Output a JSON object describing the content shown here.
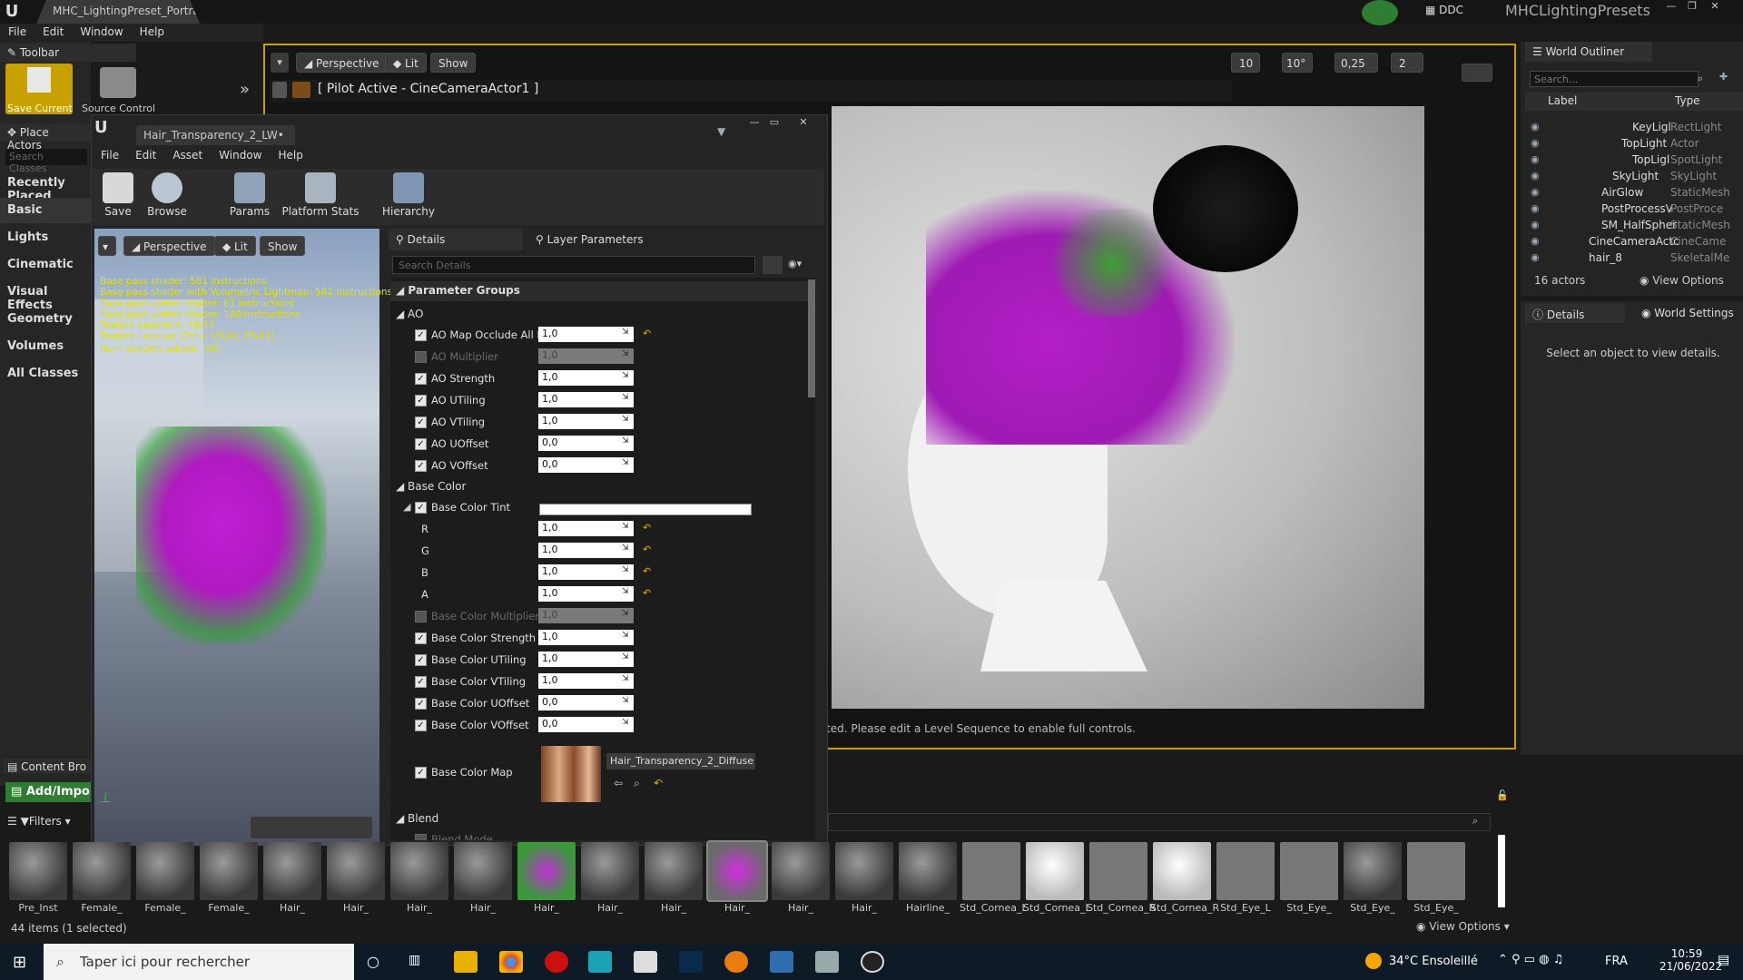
{
  "window": {
    "title_tab": "MHC_LightingPreset_Portra•",
    "project": "MHCLightingPresets",
    "ddc": "DDC"
  },
  "menubar": [
    "File",
    "Edit",
    "Window",
    "Help"
  ],
  "toolbar": {
    "title": "Toolbar",
    "save_label": "Save Current",
    "source_label": "Source Control"
  },
  "place_actors": {
    "title": "Place Actors",
    "search_placeholder": "Search Classes",
    "items": [
      "Recently Placed",
      "Basic",
      "Lights",
      "Cinematic",
      "Visual Effects",
      "Geometry",
      "Volumes",
      "All Classes"
    ]
  },
  "viewport": {
    "mode": "Perspective",
    "lit": "Lit",
    "show": "Show",
    "pilot": "[ Pilot Active - CineCameraActor1 ]",
    "grid": "10",
    "angle": "10°",
    "scale": "0,25",
    "cams": "2",
    "message": "ted. Please edit a Level Sequence to enable full controls."
  },
  "outliner": {
    "title": "World Outliner",
    "search": "Search...",
    "col_label": "Label",
    "col_type": "Type",
    "actor_count": "16 actors",
    "view_options": "View Options",
    "rows": [
      {
        "label": "KeyLigl",
        "type": "RectLight"
      },
      {
        "label": "TopLight",
        "type": "Actor"
      },
      {
        "label": "TopLigl",
        "type": "SpotLight"
      },
      {
        "label": "SkyLight",
        "type": "SkyLight"
      },
      {
        "label": "AirGlow",
        "type": "StaticMesh"
      },
      {
        "label": "PostProcessV",
        "type": "PostProce"
      },
      {
        "label": "SM_HalfSpher",
        "type": "StaticMesh"
      },
      {
        "label": "CineCameraActc",
        "type": "CineCame"
      },
      {
        "label": "hair_8",
        "type": "SkeletalMe"
      }
    ]
  },
  "details_right": {
    "tab1": "Details",
    "tab2": "World Settings",
    "empty": "Select an object to view details."
  },
  "material_editor": {
    "tab": "Hair_Transparency_2_LW•",
    "menu": [
      "File",
      "Edit",
      "Asset",
      "Window",
      "Help"
    ],
    "tools": [
      "Save",
      "Browse",
      "Params",
      "Platform Stats",
      "Hierarchy"
    ],
    "preview": {
      "mode": "Perspective",
      "lit": "Lit",
      "show": "Show"
    },
    "shader_stats": [
      "Base pass shader: 581 instructions",
      "Base pass shader with Volumetric Lightmap: 581 instructions",
      "Base pass vertex shader: 61 instructions",
      "Base pass vertex shader: 160 instructions",
      "Texture samplers: 10/16",
      "Texture Lookups (Est.): VS(0), PS(12)",
      "Num shaders added: 700"
    ],
    "details_tab": "Details",
    "layer_tab": "Layer Parameters",
    "search": "Search Details",
    "param_groups": "Parameter Groups",
    "ao": "AO",
    "base_color": "Base Color",
    "blend": "Blend",
    "blend_mode": "Blend Mode",
    "params": [
      {
        "name": "AO Map Occlude All Li",
        "value": "1,0",
        "on": true
      },
      {
        "name": "AO Multiplier",
        "value": "1,0",
        "on": false
      },
      {
        "name": "AO Strength",
        "value": "1,0",
        "on": true
      },
      {
        "name": "AO UTiling",
        "value": "1,0",
        "on": true
      },
      {
        "name": "AO VTiling",
        "value": "1,0",
        "on": true
      },
      {
        "name": "AO UOffset",
        "value": "0,0",
        "on": true
      },
      {
        "name": "AO VOffset",
        "value": "0,0",
        "on": true
      }
    ],
    "tint": "Base Color Tint",
    "channels": [
      {
        "name": "R",
        "value": "1,0"
      },
      {
        "name": "G",
        "value": "1,0"
      },
      {
        "name": "B",
        "value": "1,0"
      },
      {
        "name": "A",
        "value": "1,0"
      }
    ],
    "bc_params": [
      {
        "name": "Base Color Multiplier",
        "value": "1,0",
        "on": false
      },
      {
        "name": "Base Color Strength",
        "value": "1,0",
        "on": true
      },
      {
        "name": "Base Color UTiling",
        "value": "1,0",
        "on": true
      },
      {
        "name": "Base Color VTiling",
        "value": "1,0",
        "on": true
      },
      {
        "name": "Base Color UOffset",
        "value": "0,0",
        "on": true
      },
      {
        "name": "Base Color VOffset",
        "value": "0,0",
        "on": true
      }
    ],
    "bc_map": "Base Color Map",
    "bc_texture": "Hair_Transparency_2_Diffuse"
  },
  "content_browser": {
    "tab": "Content Bro",
    "add": "Add/Impo",
    "filters": "Filters",
    "status": "44 items (1 selected)",
    "view_options": "View Options",
    "assets": [
      "Pre_Inst",
      "Female_",
      "Female_",
      "Female_",
      "Hair_",
      "Hair_",
      "Hair_",
      "Hair_",
      "Hair_",
      "Hair_",
      "Hair_",
      "Hair_",
      "Hair_",
      "Hair_",
      "Hairline_",
      "Std_Cornea_L",
      "Std_Cornea_L",
      "Std_Cornea_R",
      "Std_Cornea_R",
      "Std_Eye_L",
      "Std_Eye_",
      "Std_Eye_",
      "Std_Eye_"
    ]
  },
  "taskbar": {
    "search": "Taper ici pour rechercher",
    "weather": "34°C Ensoleillé",
    "lang": "FRA",
    "time": "10:59",
    "date": "21/06/2022"
  }
}
